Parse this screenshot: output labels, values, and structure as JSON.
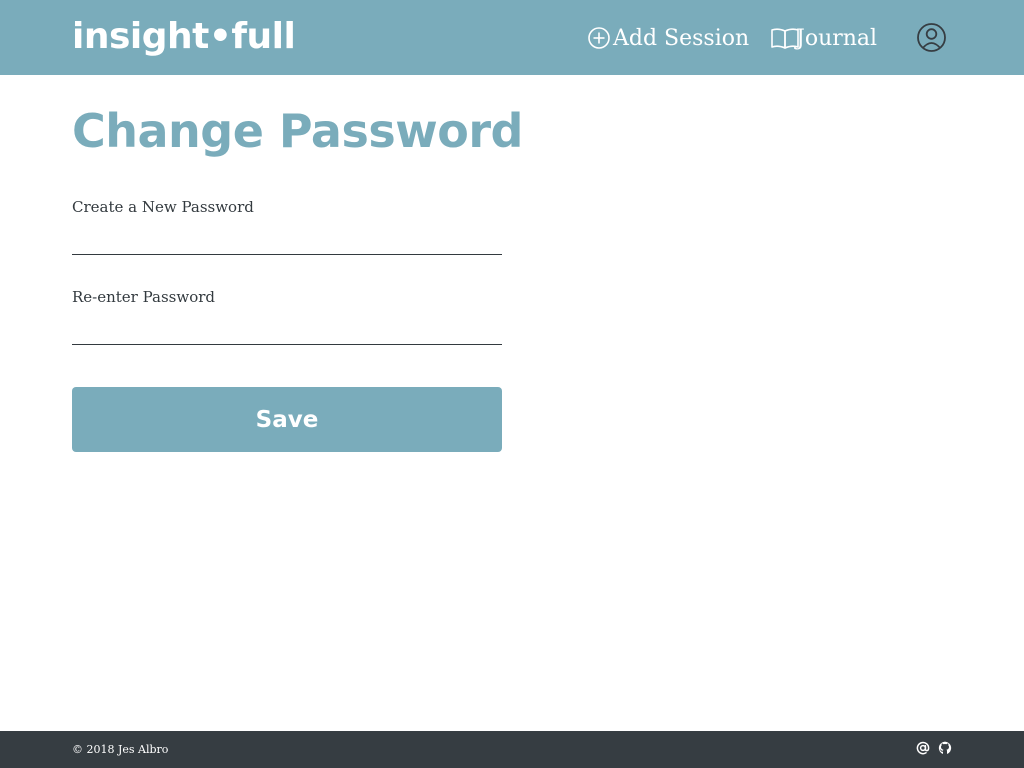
{
  "header": {
    "logo": "insight•full",
    "nav": {
      "add_session": {
        "label": "Add Session",
        "icon": "plus-circle-icon"
      },
      "journal": {
        "label": "Journal",
        "icon": "open-book-icon"
      },
      "profile": {
        "icon": "user-circle-icon"
      }
    }
  },
  "main": {
    "title": "Change Password",
    "fields": {
      "new_password": {
        "label": "Create a New Password",
        "value": "",
        "placeholder": ""
      },
      "reenter_password": {
        "label": "Re-enter Password",
        "value": "",
        "placeholder": ""
      }
    },
    "save_label": "Save"
  },
  "footer": {
    "copyright": "© 2018 Jes Albro",
    "icons": [
      "at-sign-icon",
      "github-icon"
    ]
  },
  "colors": {
    "brand": "#7aacbb",
    "footer_bg": "#363d42",
    "text": "#333a3f",
    "white": "#ffffff"
  }
}
